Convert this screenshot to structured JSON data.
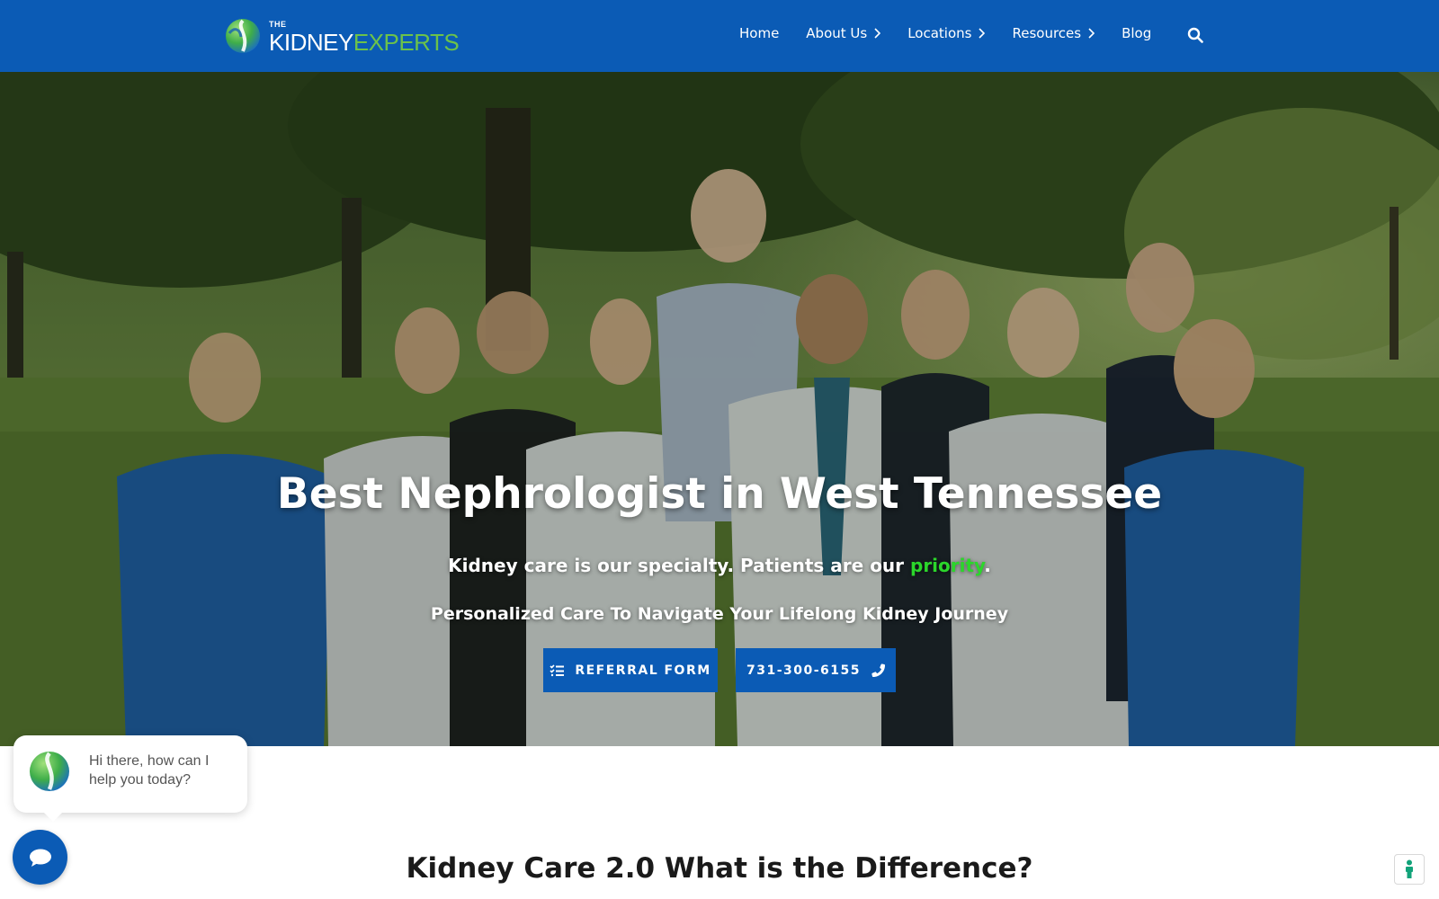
{
  "header": {
    "logo": {
      "the": "THE",
      "kidney": "KIDNEY",
      "experts": "EXPERTS"
    },
    "nav": [
      {
        "label": "Home",
        "has_dropdown": false
      },
      {
        "label": "About Us",
        "has_dropdown": true
      },
      {
        "label": "Locations",
        "has_dropdown": true
      },
      {
        "label": "Resources",
        "has_dropdown": true
      },
      {
        "label": "Blog",
        "has_dropdown": false
      }
    ],
    "search_icon": "search-icon"
  },
  "hero": {
    "title": "Best Nephrologist in West Tennessee",
    "subtitle_before": "Kidney care is our specialty. Patients are our ",
    "subtitle_highlight": "priority",
    "subtitle_after": ".",
    "tagline": "Personalized Care To Navigate Your Lifelong Kidney Journey",
    "buttons": {
      "referral": {
        "label": "REFERRAL FORM",
        "icon": "list-check-icon"
      },
      "phone": {
        "label": "731-300-6155",
        "icon": "phone-icon"
      }
    }
  },
  "chat": {
    "greeting": "Hi there, how can I help you today?",
    "launcher_icon": "chat-icon"
  },
  "section": {
    "title": "Kidney Care 2.0 What is the Difference?"
  },
  "accessibility": {
    "icon": "accessibility-icon"
  },
  "colors": {
    "brand_blue": "#0b5bb5",
    "brand_green": "#6cc24a",
    "highlight_green": "#2bd62b",
    "white": "#ffffff"
  }
}
